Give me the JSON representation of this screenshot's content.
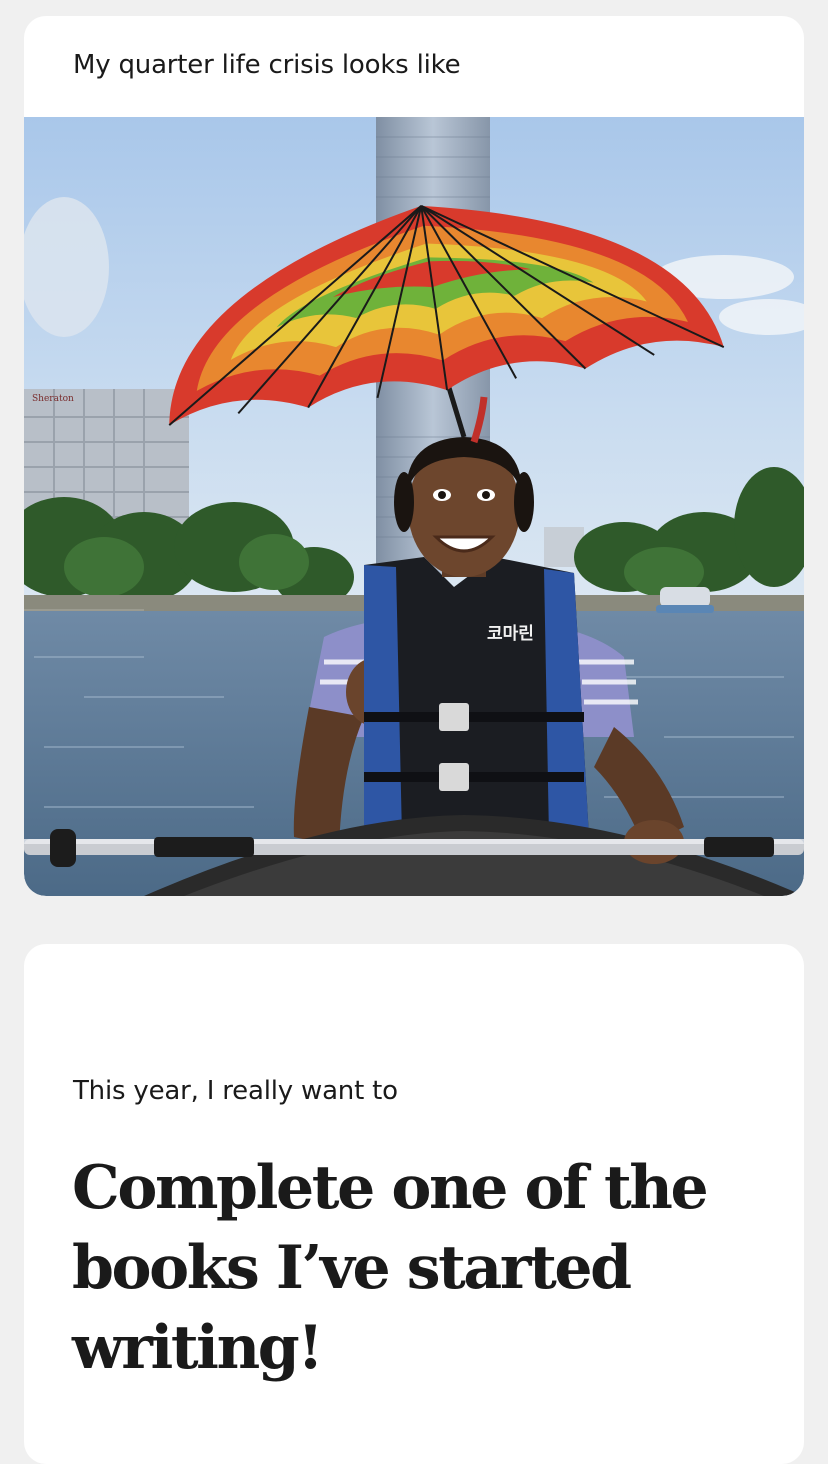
{
  "cards": [
    {
      "prompt": "My quarter life crisis looks like",
      "photo": {
        "subject": "woman in life jacket under rainbow umbrella hat in a kayak",
        "life_jacket_text": "코마린",
        "building_sign": "Sheraton"
      }
    },
    {
      "prompt": "This year, I really want to",
      "answer": "Complete one of the books I’ve started writing!"
    }
  ],
  "colors": {
    "page_background": "#f0f0f0",
    "card_background": "#ffffff",
    "text": "#1a1a1a"
  }
}
